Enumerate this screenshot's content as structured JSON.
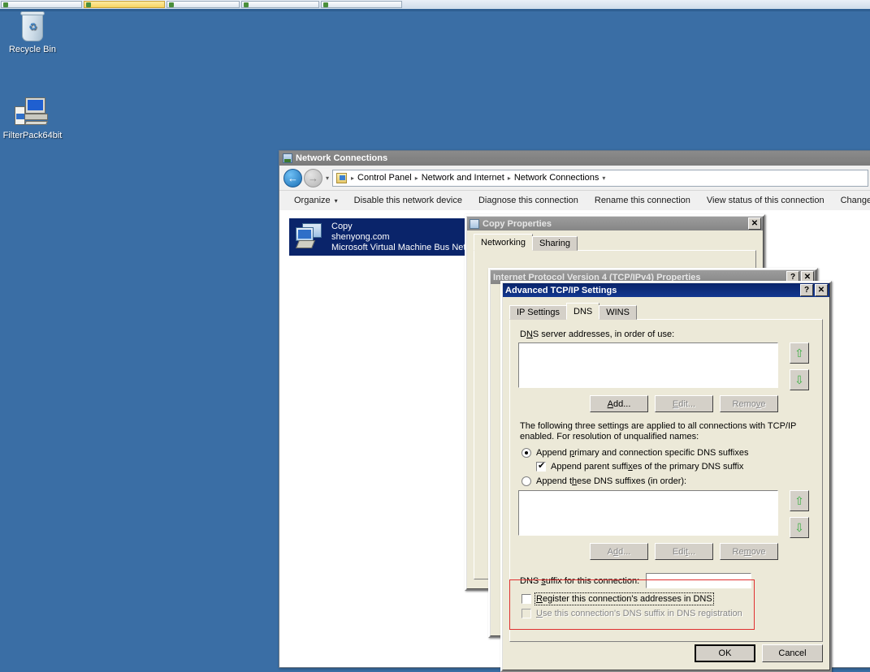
{
  "taskbar": {
    "buttons": [
      {
        "label": "",
        "selected": false
      },
      {
        "label": "",
        "selected": true
      },
      {
        "label": "",
        "selected": false
      },
      {
        "label": "",
        "selected": false
      },
      {
        "label": "",
        "selected": false
      }
    ]
  },
  "desktop": {
    "background_color": "#3a6ea5",
    "icons": [
      {
        "label": "Recycle Bin",
        "icon": "recycle-bin-icon"
      },
      {
        "label": "FilterPack64bit",
        "icon": "computer-installer-icon"
      }
    ]
  },
  "explorer": {
    "title": "Network Connections",
    "title_icon": "network-connections-icon",
    "nav": {
      "back_icon": "back-arrow-icon",
      "forward_icon": "forward-arrow-icon",
      "history_icon": "chevron-down-icon",
      "address_icon": "control-panel-icon",
      "breadcrumbs": [
        "Control Panel",
        "Network and Internet",
        "Network Connections"
      ]
    },
    "toolbar": [
      {
        "label": "Organize",
        "has_caret": true
      },
      {
        "label": "Disable this network device",
        "has_caret": false
      },
      {
        "label": "Diagnose this connection",
        "has_caret": false
      },
      {
        "label": "Rename this connection",
        "has_caret": false
      },
      {
        "label": "View status of this connection",
        "has_caret": false
      },
      {
        "label": "Change setti",
        "has_caret": false
      }
    ],
    "connection": {
      "name": "Copy",
      "network": "shenyong.com",
      "adapter": "Microsoft Virtual Machine Bus Net",
      "icon": "network-adapter-icon",
      "selected": true
    }
  },
  "copy_properties": {
    "title": "Copy Properties",
    "title_icon": "network-adapter-small-icon",
    "close_label": "✕",
    "tabs": [
      {
        "label": "Networking",
        "selected": true
      },
      {
        "label": "Sharing",
        "selected": false
      }
    ]
  },
  "ipv4_properties": {
    "title": "Internet Protocol Version 4 (TCP/IPv4) Properties",
    "help_label": "?",
    "close_label": "✕"
  },
  "advanced": {
    "title": "Advanced TCP/IP Settings",
    "help_label": "?",
    "close_label": "✕",
    "tabs": [
      {
        "label": "IP Settings",
        "selected": false
      },
      {
        "label": "DNS",
        "selected": true
      },
      {
        "label": "WINS",
        "selected": false
      }
    ],
    "dns_servers": {
      "label": "DNS server addresses, in order of use:",
      "label_accel": "N",
      "items": [],
      "up_icon": "arrow-up-icon",
      "down_icon": "arrow-down-icon",
      "buttons": [
        {
          "label": "Add...",
          "accel": "A",
          "enabled": true
        },
        {
          "label": "Edit...",
          "accel": "E",
          "enabled": false
        },
        {
          "label": "Remove",
          "accel": "v",
          "enabled": false
        }
      ]
    },
    "resolution": {
      "description_line1": "The following three settings are applied to all connections with TCP/IP",
      "description_line2": "enabled. For resolution of unqualified names:",
      "option_append_primary": {
        "label": "Append primary and connection specific DNS suffixes",
        "accel": "p",
        "selected": true
      },
      "checkbox_append_parent": {
        "label": "Append parent suffixes of the primary DNS suffix",
        "accel": "x",
        "checked": true,
        "enabled": true
      },
      "option_append_these": {
        "label": "Append these DNS suffixes (in order):",
        "accel": "h",
        "selected": false
      },
      "suffix_list_items": [],
      "up_icon": "arrow-up-icon",
      "down_icon": "arrow-down-icon",
      "buttons": [
        {
          "label": "Add...",
          "accel": "d",
          "enabled": false
        },
        {
          "label": "Edit...",
          "accel": "t",
          "enabled": false
        },
        {
          "label": "Remove",
          "accel": "m",
          "enabled": false
        }
      ]
    },
    "connection_suffix": {
      "label": "DNS suffix for this connection:",
      "accel": "s",
      "value": "",
      "checkbox_register": {
        "label": "Register this connection's addresses in DNS",
        "accel": "R",
        "checked": false,
        "enabled": true,
        "focused": true
      },
      "checkbox_use_suffix": {
        "label": "Use this connection's DNS suffix in DNS registration",
        "accel": "U",
        "checked": false,
        "enabled": false
      },
      "highlight_color": "#e03030"
    },
    "footer": {
      "ok_label": "OK",
      "ok_default": true,
      "cancel_label": "Cancel"
    }
  }
}
